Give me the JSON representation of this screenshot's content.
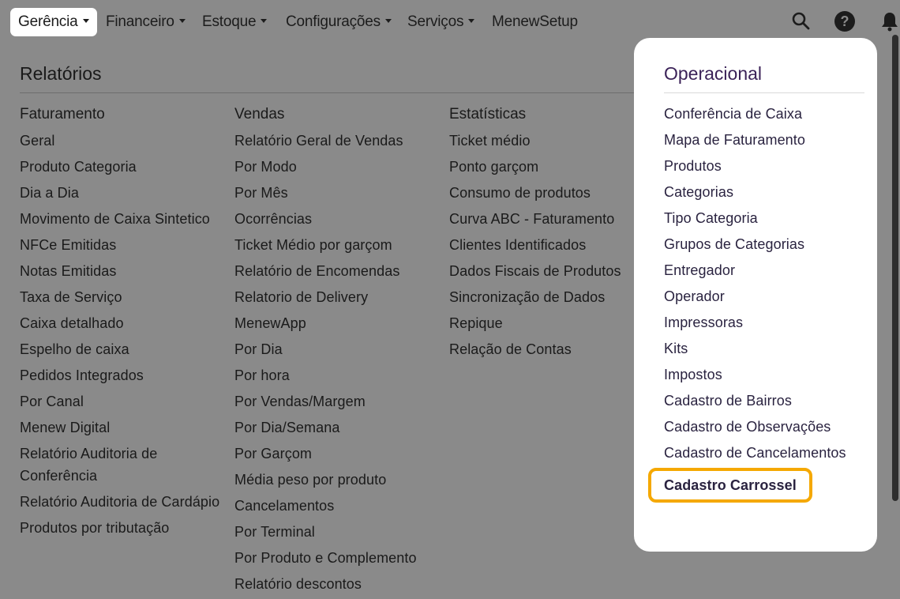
{
  "nav": {
    "items": [
      {
        "label": "Gerência",
        "active": true
      },
      {
        "label": "Financeiro"
      },
      {
        "label": "Estoque"
      },
      {
        "label": "Configurações"
      },
      {
        "label": "Serviços"
      },
      {
        "label": "MenewSetup"
      }
    ],
    "icons": [
      "search-icon",
      "help-icon",
      "bell-icon"
    ]
  },
  "relatorios": {
    "title": "Relatórios",
    "columns": [
      {
        "heading": "Faturamento",
        "items": [
          "Geral",
          "Produto Categoria",
          "Dia a Dia",
          "Movimento de Caixa Sintetico",
          "NFCe Emitidas",
          "Notas Emitidas",
          "Taxa de Serviço",
          "Caixa detalhado",
          "Espelho de caixa",
          "Pedidos Integrados",
          "Por Canal",
          "Menew Digital",
          "Relatório Auditoria de Conferência",
          "Relatório Auditoria de Cardápio",
          "Produtos por tributação"
        ]
      },
      {
        "heading": "Vendas",
        "items": [
          "Relatório Geral de Vendas",
          "Por Modo",
          "Por Mês",
          "Ocorrências",
          "Ticket Médio por garçom",
          "Relatório de Encomendas",
          "Relatorio de Delivery",
          "MenewApp",
          "Por Dia",
          "Por hora",
          "Por Vendas/Margem",
          "Por Dia/Semana",
          "Por Garçom",
          "Média peso por produto",
          "Cancelamentos",
          "Por Terminal",
          "Por Produto e Complemento",
          "Relatório descontos"
        ]
      },
      {
        "heading": "Estatísticas",
        "items": [
          "Ticket médio",
          "Ponto garçom",
          "Consumo de produtos",
          "Curva ABC - Faturamento",
          "Clientes Identificados",
          "Dados Fiscais de Produtos",
          "Sincronização de Dados",
          "Repique",
          "Relação de Contas"
        ]
      }
    ]
  },
  "operacional": {
    "title": "Operacional",
    "items": [
      "Conferência de Caixa",
      "Mapa de Faturamento",
      "Produtos",
      "Categorias",
      "Tipo Categoria",
      "Grupos de Categorias",
      "Entregador",
      "Operador",
      "Impressoras",
      "Kits",
      "Impostos",
      "Cadastro de Bairros",
      "Cadastro de Observações",
      "Cadastro de Cancelamentos"
    ],
    "highlighted_item": "Cadastro Carrossel"
  },
  "colors": {
    "highlight_border": "#f5a800",
    "panel_title": "#3b2258",
    "overlay": "#8a8a8a"
  }
}
